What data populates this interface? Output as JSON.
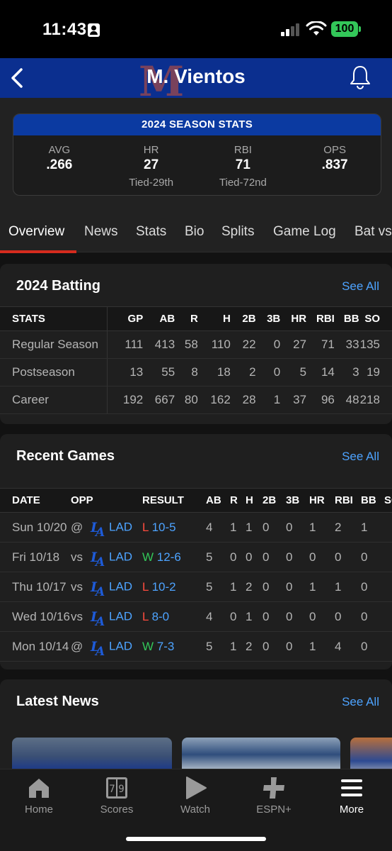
{
  "status_bar": {
    "time": "11:43",
    "battery": "100"
  },
  "header": {
    "title": "M. Vientos",
    "bg_color": "#0b2f8f"
  },
  "season_stats": {
    "heading": "2024 SEASON STATS",
    "stats": [
      {
        "label": "AVG",
        "value": ".266",
        "rank": ""
      },
      {
        "label": "HR",
        "value": "27",
        "rank": "Tied-29th"
      },
      {
        "label": "RBI",
        "value": "71",
        "rank": "Tied-72nd"
      },
      {
        "label": "OPS",
        "value": ".837",
        "rank": ""
      }
    ]
  },
  "tabs": [
    "Overview",
    "News",
    "Stats",
    "Bio",
    "Splits",
    "Game Log",
    "Bat vs"
  ],
  "active_tab": "Overview",
  "batting": {
    "title": "2024 Batting",
    "see_all": "See All",
    "columns": [
      "STATS",
      "GP",
      "AB",
      "R",
      "H",
      "2B",
      "3B",
      "HR",
      "RBI",
      "BB",
      "SO"
    ],
    "rows": [
      [
        "Regular Season",
        "111",
        "413",
        "58",
        "110",
        "22",
        "0",
        "27",
        "71",
        "33",
        "135"
      ],
      [
        "Postseason",
        "13",
        "55",
        "8",
        "18",
        "2",
        "0",
        "5",
        "14",
        "3",
        "19"
      ],
      [
        "Career",
        "192",
        "667",
        "80",
        "162",
        "28",
        "1",
        "37",
        "96",
        "48",
        "218"
      ]
    ]
  },
  "recent_games": {
    "title": "Recent Games",
    "see_all": "See All",
    "columns": [
      "DATE",
      "OPP",
      "RESULT",
      "AB",
      "R",
      "H",
      "2B",
      "3B",
      "HR",
      "RBI",
      "BB",
      "SO"
    ],
    "rows": [
      {
        "date": "Sun 10/20",
        "venue": "@",
        "team": "LAD",
        "wl": "L",
        "score": "10-5",
        "stats": [
          "4",
          "1",
          "1",
          "0",
          "0",
          "1",
          "2",
          "1"
        ]
      },
      {
        "date": "Fri 10/18",
        "venue": "vs",
        "team": "LAD",
        "wl": "W",
        "score": "12-6",
        "stats": [
          "5",
          "0",
          "0",
          "0",
          "0",
          "0",
          "0",
          "0"
        ]
      },
      {
        "date": "Thu 10/17",
        "venue": "vs",
        "team": "LAD",
        "wl": "L",
        "score": "10-2",
        "stats": [
          "5",
          "1",
          "2",
          "0",
          "0",
          "1",
          "1",
          "0"
        ]
      },
      {
        "date": "Wed 10/16",
        "venue": "vs",
        "team": "LAD",
        "wl": "L",
        "score": "8-0",
        "stats": [
          "4",
          "0",
          "1",
          "0",
          "0",
          "0",
          "0",
          "0"
        ]
      },
      {
        "date": "Mon 10/14",
        "venue": "@",
        "team": "LAD",
        "wl": "W",
        "score": "7-3",
        "stats": [
          "5",
          "1",
          "2",
          "0",
          "0",
          "1",
          "4",
          "0"
        ]
      }
    ]
  },
  "latest_news": {
    "title": "Latest News",
    "see_all": "See All"
  },
  "bottom_nav": [
    {
      "label": "Home",
      "icon": "home-icon"
    },
    {
      "label": "Scores",
      "icon": "scores-icon"
    },
    {
      "label": "Watch",
      "icon": "play-icon"
    },
    {
      "label": "ESPN+",
      "icon": "plus-icon"
    },
    {
      "label": "More",
      "icon": "menu-icon"
    }
  ],
  "colors": {
    "accent_link": "#4da3ff",
    "loss": "#ff4b3e",
    "win": "#33c759",
    "tab_underline": "#d52b1e"
  }
}
